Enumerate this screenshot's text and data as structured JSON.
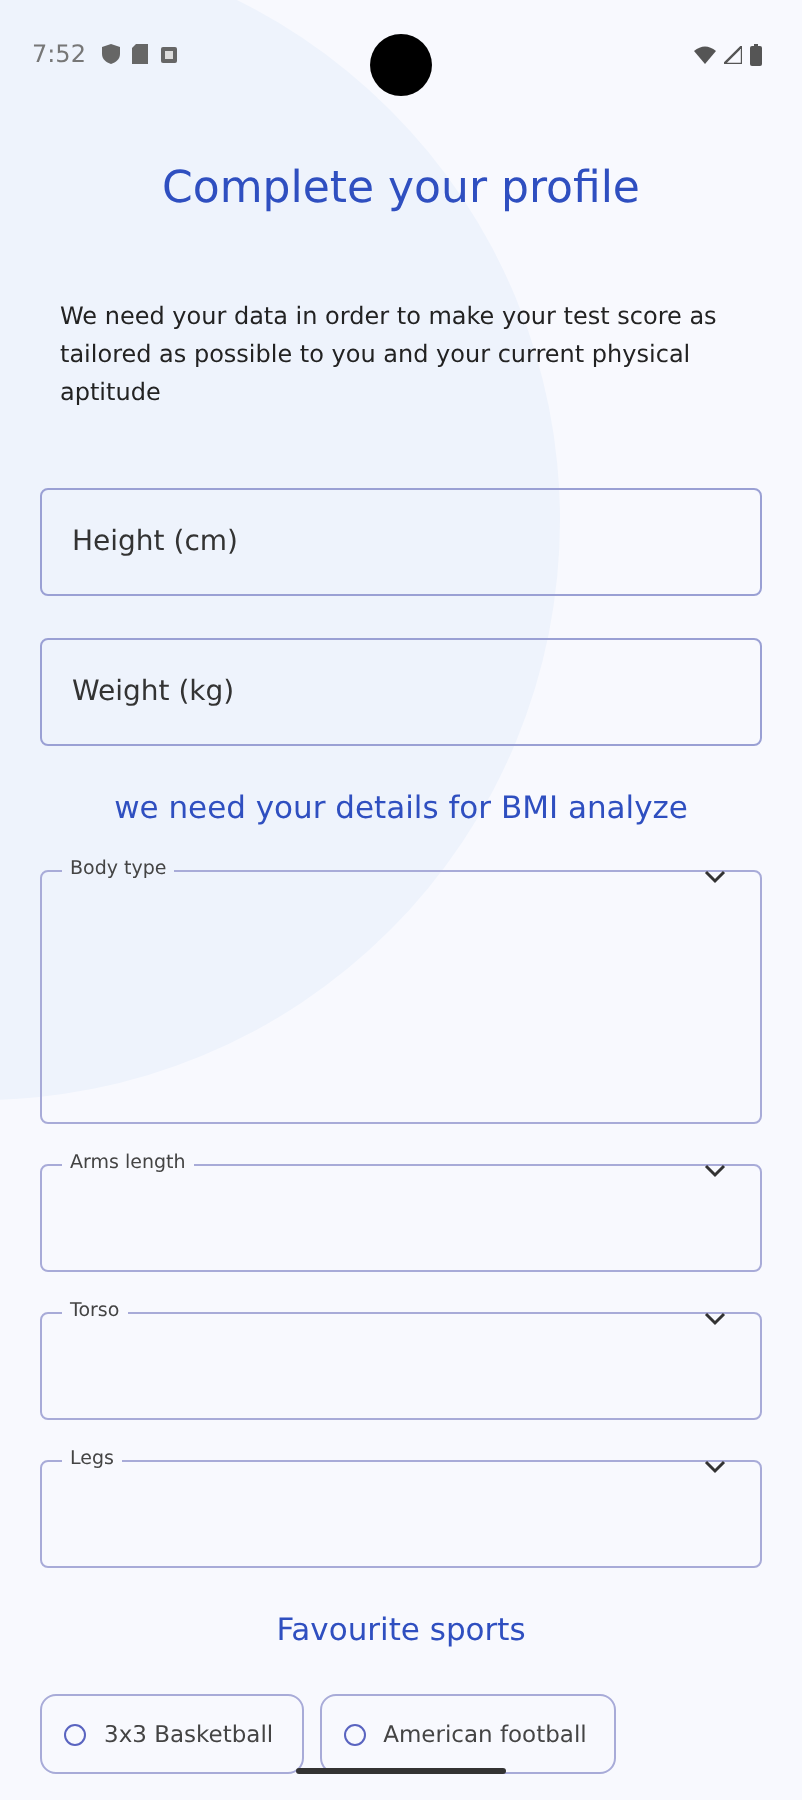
{
  "status_bar": {
    "time": "7:52"
  },
  "title": "Complete your profile",
  "description": "We need your data in order to make your test score as tailored as possible to you and your current physical aptitude",
  "fields": [
    {
      "kind": "text",
      "placeholder": "Height (cm)"
    },
    {
      "kind": "text",
      "placeholder": "Weight (kg)"
    }
  ],
  "bmi_heading": "we need  your details for BMI analyze",
  "selects": [
    {
      "label": "Body type",
      "tall": true
    },
    {
      "label": "Arms length",
      "tall": false
    },
    {
      "label": "Torso",
      "tall": false
    },
    {
      "label": "Legs",
      "tall": false
    }
  ],
  "sports_heading": "Favourite sports",
  "sports": [
    {
      "label": "3x3 Basketball",
      "selected": false
    },
    {
      "label": "American football",
      "selected": false
    }
  ]
}
